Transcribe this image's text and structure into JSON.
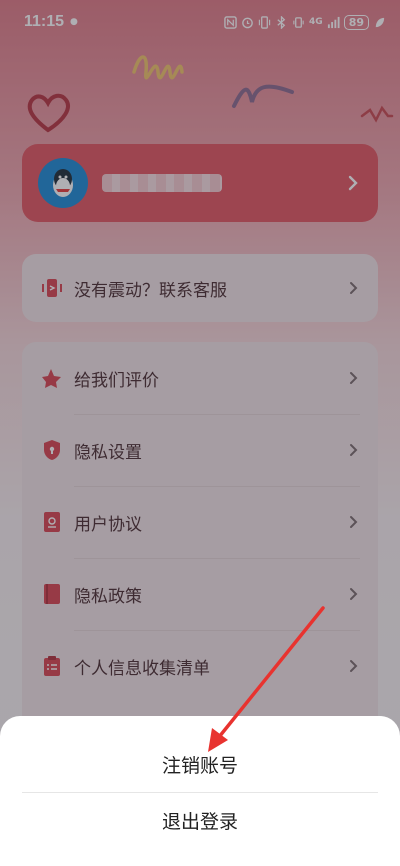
{
  "status_bar": {
    "time": "11:15",
    "network": "4G",
    "battery": "89"
  },
  "profile": {
    "username": "••••••••"
  },
  "support": {
    "label": "没有震动？联系客服"
  },
  "menu": {
    "items": [
      {
        "label": "给我们评价",
        "icon": "star-icon"
      },
      {
        "label": "隐私设置",
        "icon": "shield-icon"
      },
      {
        "label": "用户协议",
        "icon": "document-icon"
      },
      {
        "label": "隐私政策",
        "icon": "book-icon"
      },
      {
        "label": "个人信息收集清单",
        "icon": "clipboard-icon"
      }
    ]
  },
  "sheet": {
    "cancel_account": "注销账号",
    "logout": "退出登录"
  },
  "colors": {
    "accent": "#e2545f",
    "arrow": "#e8332f"
  }
}
